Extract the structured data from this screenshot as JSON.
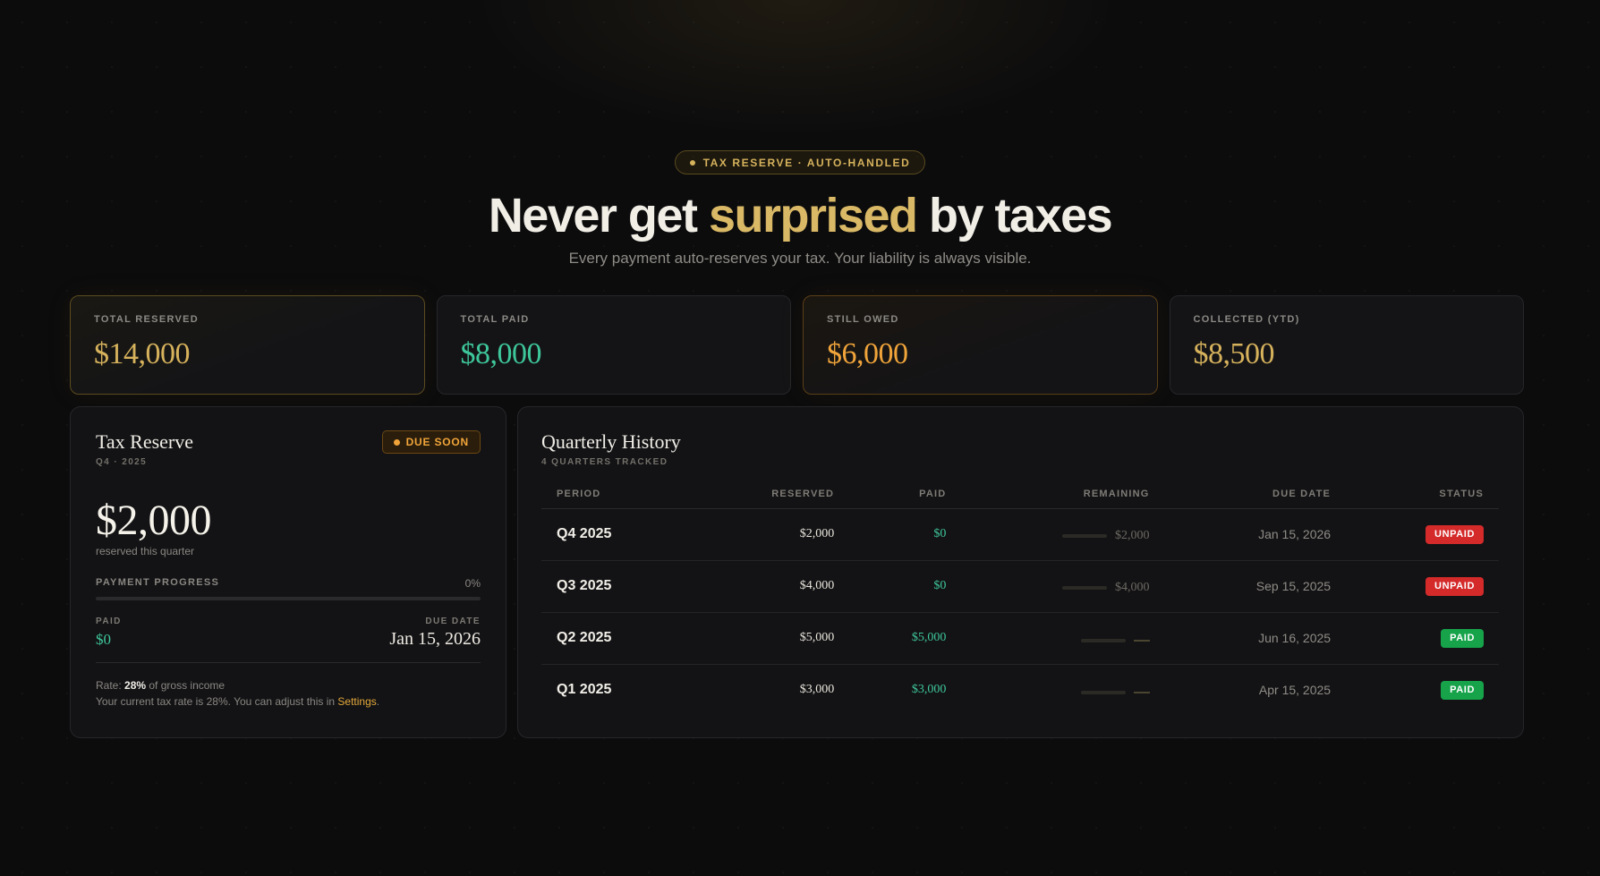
{
  "hero": {
    "pill": "TAX RESERVE · AUTO-HANDLED",
    "headline_pre": "Never get ",
    "headline_accent": "surprised",
    "headline_post": " by taxes",
    "subline": "Every payment auto-reserves your tax. Your liability is always visible."
  },
  "stats": [
    {
      "label": "TOTAL RESERVED",
      "value": "$14,000",
      "color": "#d6b25c"
    },
    {
      "label": "TOTAL PAID",
      "value": "$8,000",
      "color": "#3ec79a"
    },
    {
      "label": "STILL OWED",
      "value": "$6,000",
      "color": "#f0a43a"
    },
    {
      "label": "COLLECTED (YTD)",
      "value": "$8,500",
      "color": "#d6b25c"
    }
  ],
  "reserve": {
    "title": "Tax Reserve",
    "subtitle": "Q4 · 2025",
    "badge": "DUE SOON",
    "amount": "$2,000",
    "amount_sub": "reserved this quarter",
    "progress_label": "PAYMENT PROGRESS",
    "progress_pct_text": "0%",
    "progress_fraction": 0,
    "paid_label": "PAID",
    "paid_value": "$0",
    "due_label": "DUE DATE",
    "due_value": "Jan 15, 2026",
    "rate_prefix": "Rate: ",
    "rate_value": "28%",
    "rate_suffix": " of gross income",
    "rate_note_prefix": "Your current tax rate is 28%. You can adjust this in ",
    "rate_note_link": "Settings",
    "rate_note_suffix": "."
  },
  "history": {
    "title": "Quarterly History",
    "subtitle": "4 QUARTERS TRACKED",
    "columns": [
      "PERIOD",
      "RESERVED",
      "PAID",
      "REMAINING",
      "DUE DATE",
      "STATUS"
    ],
    "rows": [
      {
        "period": "Q4 2025",
        "reserved": "$2,000",
        "paid": "$0",
        "remaining": "$2,000",
        "paid_fraction": 0,
        "due": "Jan 15, 2026",
        "status": "UNPAID"
      },
      {
        "period": "Q3 2025",
        "reserved": "$4,000",
        "paid": "$0",
        "remaining": "$4,000",
        "paid_fraction": 0,
        "due": "Sep 15, 2025",
        "status": "UNPAID"
      },
      {
        "period": "Q2 2025",
        "reserved": "$5,000",
        "paid": "$5,000",
        "remaining": "",
        "paid_fraction": 1,
        "due": "Jun 16, 2025",
        "status": "PAID"
      },
      {
        "period": "Q1 2025",
        "reserved": "$3,000",
        "paid": "$3,000",
        "remaining": "",
        "paid_fraction": 1,
        "due": "Apr 15, 2025",
        "status": "PAID"
      }
    ]
  }
}
